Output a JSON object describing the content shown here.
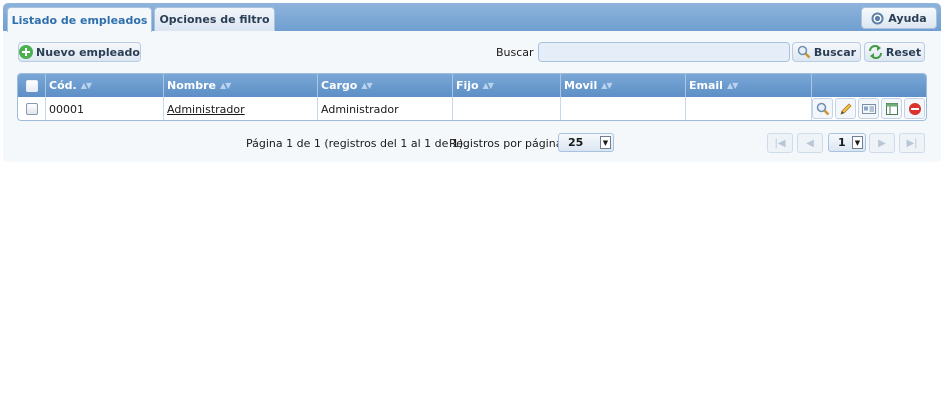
{
  "tabs": [
    {
      "label": "Listado de empleados",
      "active": true
    },
    {
      "label": "Opciones de filtro",
      "active": false
    }
  ],
  "help": {
    "label": "Ayuda",
    "icon": "help-icon"
  },
  "toolbar": {
    "new_label": "Nuevo empleado",
    "new_icon": "plus-icon",
    "search_label": "Buscar",
    "search_value": "",
    "search_button": "Buscar",
    "reset_button": "Reset"
  },
  "grid": {
    "columns": [
      "Cód.",
      "Nombre",
      "Cargo",
      "Fijo",
      "Movil",
      "Email"
    ],
    "rows": [
      {
        "code": "00001",
        "name": "Administrador",
        "role": "Administrador",
        "phone": "",
        "mobile": "",
        "email": ""
      }
    ],
    "actions": [
      "view-icon",
      "edit-icon",
      "card-icon",
      "sheet-icon",
      "delete-icon"
    ]
  },
  "pager": {
    "summary": "Página 1 de 1 (registros del 1 al 1 de 1).",
    "per_page_label": "Registros por página:",
    "per_page": "25",
    "page": "1"
  },
  "colors": {
    "accent": "#5d8fc6",
    "tab_active_text": "#2e6fad",
    "add_green": "#4caf50",
    "delete_red": "#d9342b"
  }
}
